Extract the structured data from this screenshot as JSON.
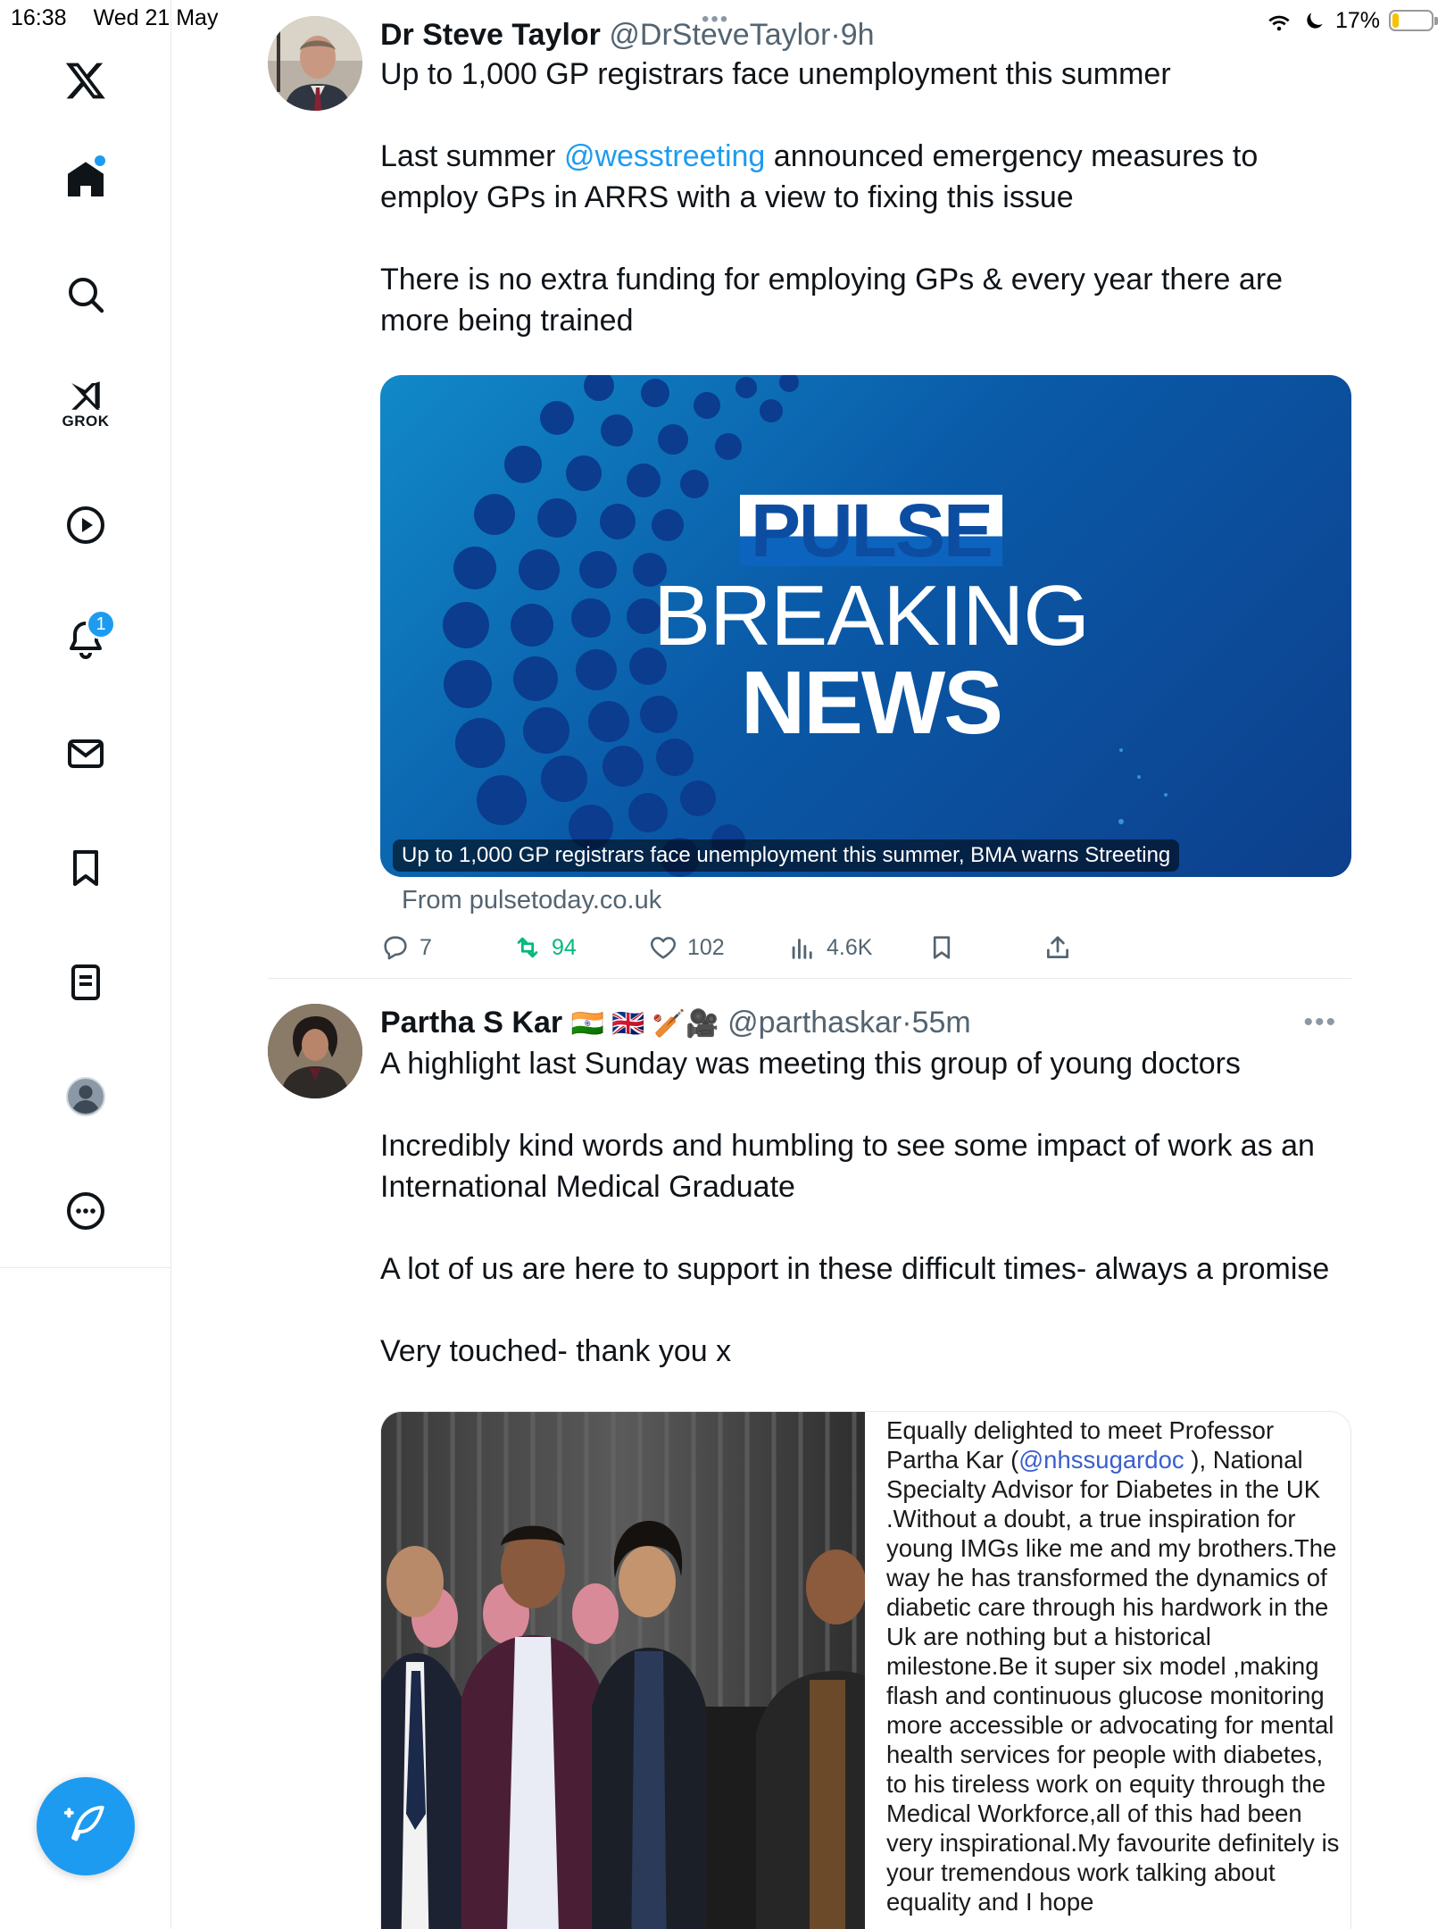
{
  "status_bar": {
    "time": "16:38",
    "date": "Wed 21 May",
    "battery": "17%",
    "battery_level": 0.17
  },
  "sidebar": {
    "items": [
      {
        "name": "x-logo",
        "label": ""
      },
      {
        "name": "home",
        "label": ""
      },
      {
        "name": "search",
        "label": ""
      },
      {
        "name": "grok",
        "label": "GROK"
      },
      {
        "name": "videos",
        "label": ""
      },
      {
        "name": "notifications",
        "label": "",
        "badge": "1"
      },
      {
        "name": "messages",
        "label": ""
      },
      {
        "name": "bookmarks",
        "label": ""
      },
      {
        "name": "lists",
        "label": ""
      },
      {
        "name": "profile",
        "label": ""
      },
      {
        "name": "more",
        "label": ""
      }
    ]
  },
  "tweets": [
    {
      "name": "Dr Steve Taylor",
      "handle": "@DrSteveTaylor",
      "sep": "·",
      "time": "9h",
      "paragraphs": [
        {
          "lines": [
            "Up to 1,000 GP registrars face unemployment this summer"
          ]
        },
        {
          "before": "Last summer ",
          "mention": "@wesstreeting",
          "after": " announced emergency measures to employ GPs in ARRS with a view to fixing this issue"
        },
        {
          "lines": [
            "There is no extra funding for employing GPs & every year there are more being trained"
          ]
        }
      ],
      "card": {
        "brand": "PULSE",
        "headline_1": "BREAKING",
        "headline_2": "NEWS",
        "caption": "Up to 1,000 GP registrars face unemployment this summer, BMA warns Streeting",
        "source": "From pulsetoday.co.uk"
      },
      "actions": {
        "replies": "7",
        "retweets": "94",
        "likes": "102",
        "views": "4.6K"
      }
    },
    {
      "name": "Partha S Kar",
      "flags": "🇮🇳 🇬🇧 🏏🎥",
      "handle": "@parthaskar",
      "sep": "·",
      "time": "55m",
      "paragraphs": [
        "A highlight last Sunday was meeting this group of young doctors",
        "Incredibly kind words and humbling to see some impact of work as an International Medical Graduate",
        "A lot of us are here to support in these difficult times- always a promise",
        "Very touched- thank you x"
      ],
      "quote": {
        "before": "Equally delighted to meet Professor Partha Kar (",
        "mention": "@nhssugardoc",
        "after": " ), National Specialty Advisor for Diabetes in the UK .Without a doubt, a true inspiration for young IMGs like me and my brothers.The way he has transformed the dynamics of diabetic care through his hardwork in the Uk are nothing but a historical milestone.Be it super six model ,making flash and continuous glucose monitoring more accessible or advocating for mental health services for people with diabetes, to his tireless work on equity through the Medical Workforce,all of this had been very inspirational.My favourite definitely is your tremendous work talking about equality and I hope"
      }
    }
  ],
  "colors": {
    "accent": "#1d9bf0",
    "retweet": "#00ba7c",
    "secondary_text": "#536471",
    "card_blue": "#0a5aa8"
  }
}
